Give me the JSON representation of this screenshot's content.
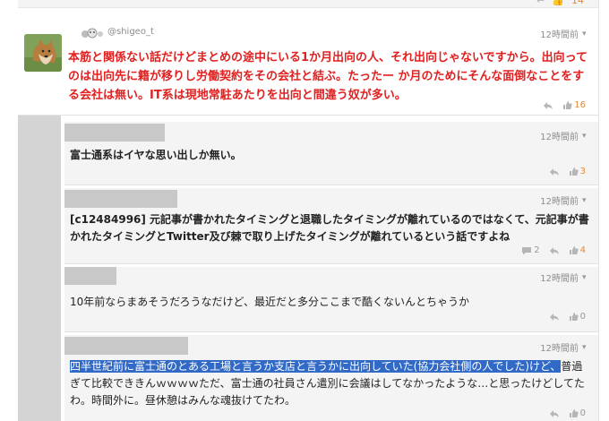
{
  "top": {
    "like_count": "14"
  },
  "comments": [
    {
      "username": "@shigeo_t",
      "time": "12時間前",
      "body": "本筋と関係ない話だけどまとめの途中にいる1か月出向の人、それ出向じゃないですから。出向ってのは出向先に籍が移りし労働契約をその会社と結ぶ。たったー か月のためにそんな面倒なことをする会社は無い。IT系は現地常駐あたりを出向と間違う奴が多い。",
      "like_count": "16"
    },
    {
      "time": "12時間前",
      "body": "富士通系はイヤな思い出しか無い。",
      "like_count": "3"
    },
    {
      "time": "12時間前",
      "body": "[c12484996] 元記事が書かれたタイミングと退職したタイミングが離れているのではなくて、元記事が書かれたタイミングとTwitter及び棘で取り上げたタイミングが離れているという話ですよね",
      "reply_count": "2",
      "like_count": "4"
    },
    {
      "time": "12時間前",
      "body": "10年前ならまあそうだろうなだけど、最近だと多分ここまで酷くないんとちゃうか",
      "like_count": "0"
    },
    {
      "time": "12時間前",
      "body_highlight": "四半世紀前に富士通のとある工場と言うか支店と言うかに出向していた(協力会社側の人でした)けど、",
      "body_rest": "普過ぎて比較でききんｗｗｗｗただ、富士通の社員さん遣別に会議はしてなかったような…と思ったけどしてたわ。時間外に。昼休憩はみんな魂抜けてたわ。",
      "like_count": "0"
    }
  ],
  "icons": [
    "reply-icon",
    "thumbs-up-icon",
    "comment-bubble-icon",
    "chevron-down-icon"
  ],
  "colors": {
    "accent": "#e58a33",
    "red_text": "#e12020",
    "highlight": "#3169c6"
  }
}
